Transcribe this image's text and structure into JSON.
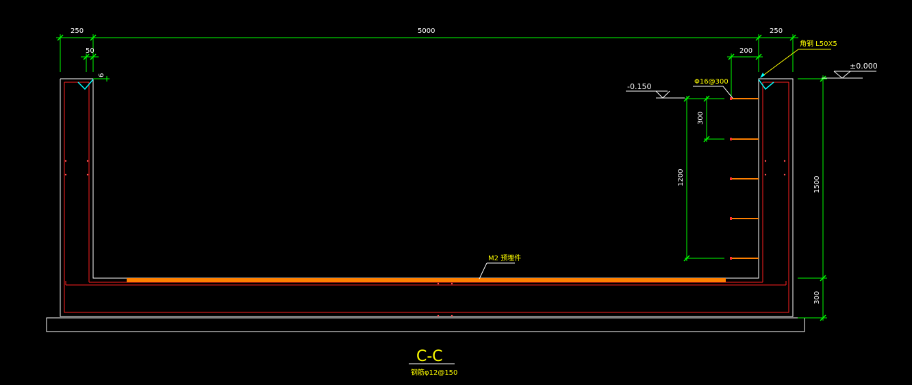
{
  "dimensions": {
    "left_wall": "250",
    "span": "5000",
    "right_wall": "250",
    "corner_offset": "50",
    "bar_length": "200",
    "small_tag": "6",
    "bar_spacing_dim": "300",
    "bar_zone_height": "1200",
    "wall_height": "1500",
    "slab_thickness": "300"
  },
  "labels": {
    "angle_steel": "角钢 L50X5",
    "top_elevation": "±0.000",
    "bar_elevation": "-0.150",
    "bar_callout": "Φ16@300",
    "mortar_layer": "M2 预埋件",
    "section_title": "C-C",
    "section_note": "钢筋φ12@150"
  },
  "colors": {
    "background": "#000000",
    "outline": "#ffffff",
    "dimension": "#00ff00",
    "rebar": "#ff2020",
    "anchor_bar": "#ff8000",
    "angle": "#00ffff",
    "annotation": "#ffff00"
  }
}
